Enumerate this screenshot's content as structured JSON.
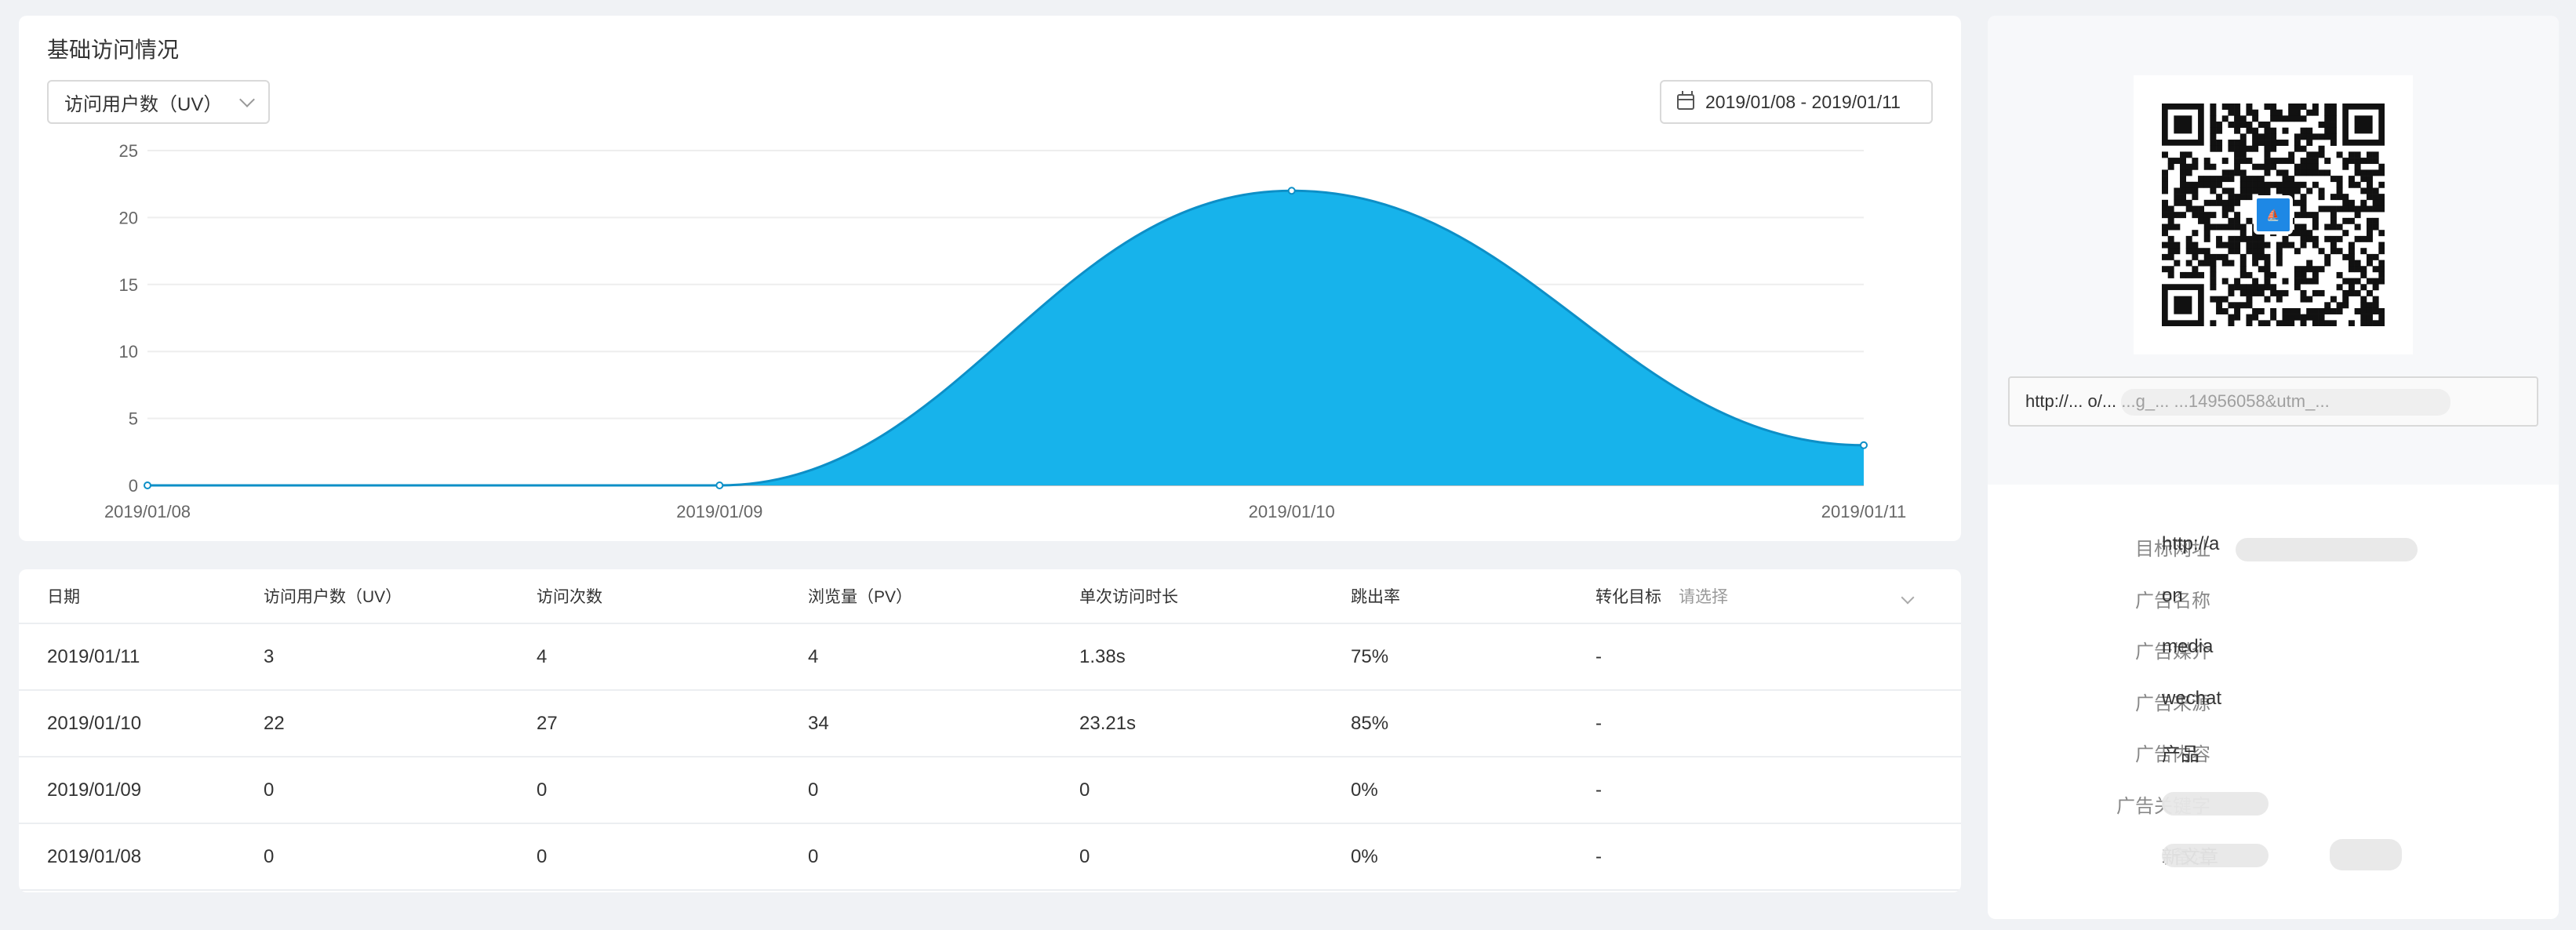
{
  "chart_card": {
    "title": "基础访问情况",
    "metric_select": "访问用户数（UV）",
    "date_range": "2019/01/08 - 2019/01/11"
  },
  "chart_data": {
    "type": "area",
    "x": [
      "2019/01/08",
      "2019/01/09",
      "2019/01/10",
      "2019/01/11"
    ],
    "series": [
      {
        "values": [
          0,
          0,
          22,
          3
        ]
      }
    ],
    "yticks": [
      0,
      5,
      10,
      15,
      20,
      25
    ],
    "ylim": [
      0,
      25
    ],
    "grid": true,
    "color": "#17b3eb"
  },
  "table": {
    "columns": [
      "日期",
      "访问用户数（UV）",
      "访问次数",
      "浏览量（PV）",
      "单次访问时长",
      "跳出率",
      "转化目标"
    ],
    "conversion_placeholder": "请选择",
    "rows": [
      [
        "2019/01/11",
        "3",
        "4",
        "4",
        "1.38s",
        "75%",
        "-"
      ],
      [
        "2019/01/10",
        "22",
        "27",
        "34",
        "23.21s",
        "85%",
        "-"
      ],
      [
        "2019/01/09",
        "0",
        "0",
        "0",
        "0",
        "0%",
        "-"
      ],
      [
        "2019/01/08",
        "0",
        "0",
        "0",
        "0",
        "0%",
        "-"
      ]
    ]
  },
  "right_panel": {
    "url_text": "http://...               o/...    ...g_...   ...14956058&utm_...",
    "info": [
      {
        "label": "目标网址",
        "value": "http://a"
      },
      {
        "label": "广告名称",
        "value": "on"
      },
      {
        "label": "广告媒介",
        "value": "media"
      },
      {
        "label": "广告来源",
        "value": "wechat"
      },
      {
        "label": "广告内容",
        "value": "产品"
      },
      {
        "label": "广告关键字",
        "value": ""
      },
      {
        "label": "备注",
        "value": "新文章"
      }
    ]
  }
}
